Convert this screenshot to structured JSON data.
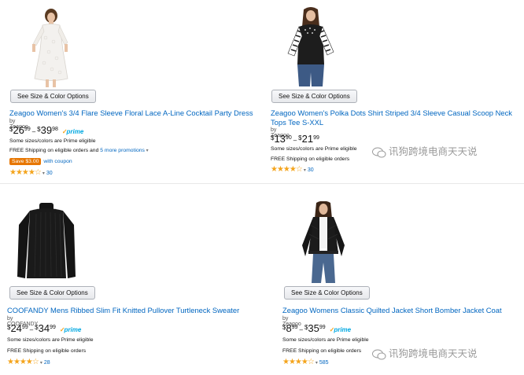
{
  "products": [
    {
      "button": "See Size & Color Options",
      "title": "Zeagoo Women's 3/4 Flare Sleeve Floral Lace A-Line Cocktail Party Dress",
      "brand": "by Zeagoo",
      "price_low": {
        "currency": "$",
        "dollars": "26",
        "cents": "99"
      },
      "price_high": {
        "currency": "$",
        "dollars": "39",
        "cents": "98"
      },
      "prime": "prime",
      "prime_note": "Some sizes/colors are Prime eligible",
      "shipping": "FREE Shipping on eligible orders and",
      "promotions": "5 more promotions",
      "save_badge": "Save $3.00",
      "coupon": "with coupon",
      "reviews": "30",
      "stars": 4.5
    },
    {
      "button": "See Size & Color Options",
      "title": "Zeagoo Women's Polka Dots Shirt Striped 3/4 Sleeve Casual Scoop Neck Tops Tee S-XXL",
      "brand": "by Zeagoo",
      "price_low": {
        "currency": "$",
        "dollars": "13",
        "cents": "90"
      },
      "price_high": {
        "currency": "$",
        "dollars": "21",
        "cents": "99"
      },
      "prime_note": "Some sizes/colors are Prime eligible",
      "shipping": "FREE Shipping on eligible orders",
      "reviews": "30",
      "stars": 4.5
    },
    {
      "button": "See Size & Color Options",
      "title": "COOFANDY Mens Ribbed Slim Fit Knitted Pullover Turtleneck Sweater",
      "brand": "by COOFANDY",
      "price_low": {
        "currency": "$",
        "dollars": "24",
        "cents": "99"
      },
      "price_high": {
        "currency": "$",
        "dollars": "34",
        "cents": "99"
      },
      "prime": "prime",
      "prime_note": "Some sizes/colors are Prime eligible",
      "shipping": "FREE Shipping on eligible orders",
      "reviews": "28",
      "stars": 4.5
    },
    {
      "button": "See Size & Color Options",
      "title": "Zeagoo Womens Classic Quilted Jacket Short Bomber Jacket Coat",
      "brand": "by Zeagoo",
      "price_low": {
        "currency": "$",
        "dollars": "8",
        "cents": "99"
      },
      "price_high": {
        "currency": "$",
        "dollars": "35",
        "cents": "99"
      },
      "prime": "prime",
      "prime_note": "Some sizes/colors are Prime eligible",
      "shipping": "FREE Shipping on eligible orders",
      "reviews": "585",
      "stars": 4.0
    }
  ],
  "watermark": "讯狗跨境电商天天说",
  "colors": {
    "link": "#0066c0",
    "star": "#f4a41c",
    "save_badge": "#e77600",
    "prime": "#00a8e1"
  }
}
